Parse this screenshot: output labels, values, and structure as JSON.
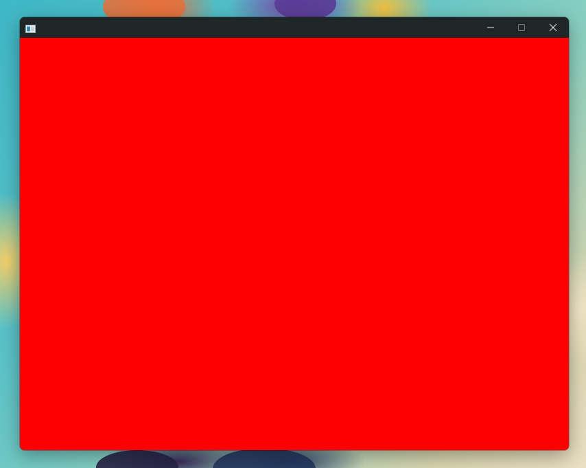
{
  "window": {
    "title": "",
    "content_color": "#ff0000",
    "titlebar_color": "#1f2628"
  },
  "titlebar": {
    "app_icon": "app-window-icon",
    "buttons": [
      {
        "name": "minimize",
        "icon": "minimize-icon"
      },
      {
        "name": "maximize",
        "icon": "maximize-icon",
        "enabled": false
      },
      {
        "name": "close",
        "icon": "close-icon"
      }
    ]
  }
}
